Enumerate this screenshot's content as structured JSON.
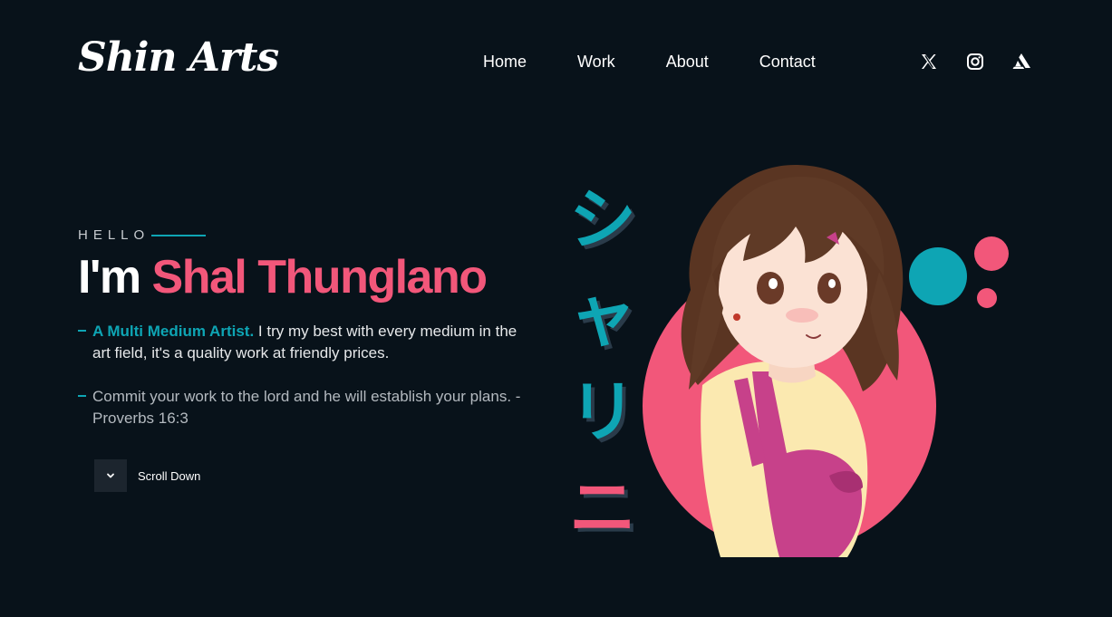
{
  "brand": {
    "logo": "Shin Arts"
  },
  "nav": {
    "items": [
      "Home",
      "Work",
      "About",
      "Contact"
    ]
  },
  "social": [
    {
      "icon": "x-twitter-icon"
    },
    {
      "icon": "instagram-icon"
    },
    {
      "icon": "artstation-icon"
    }
  ],
  "hero": {
    "greeting": "HELLO",
    "headline_prefix": "I'm",
    "headline_name": "Shal Thunglano",
    "bullet1_highlight": "A Multi Medium Artist.",
    "bullet1_text": " I try my best with every medium in the art field, it's a quality work at friendly prices.",
    "bullet2_text": "Commit your work to the lord and he will establish your plans. - Proverbs 16:3",
    "scroll_label": "Scroll Down",
    "katakana": [
      "シ",
      "ャ",
      "リ",
      "ニ"
    ]
  },
  "colors": {
    "background": "#08121a",
    "accent_teal": "#0ea5b4",
    "accent_pink": "#f2577a"
  }
}
